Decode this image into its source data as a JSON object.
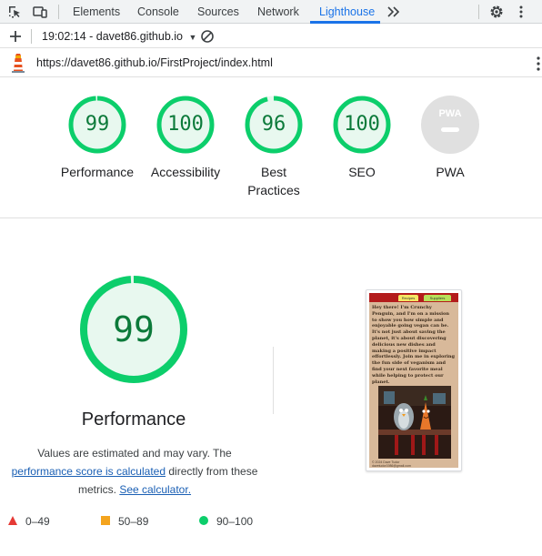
{
  "tabs": [
    {
      "label": "Elements"
    },
    {
      "label": "Console"
    },
    {
      "label": "Sources"
    },
    {
      "label": "Network"
    },
    {
      "label": "Lighthouse",
      "active": true
    }
  ],
  "toolbar": {
    "report_label": "19:02:14 - davet86.github.io"
  },
  "url": "https://davet86.github.io/FirstProject/index.html",
  "categories": [
    {
      "score": "99",
      "label": "Performance",
      "fraction": 0.99,
      "status": "pass"
    },
    {
      "score": "100",
      "label": "Accessibility",
      "fraction": 1.0,
      "status": "pass"
    },
    {
      "score": "96",
      "label": "Best Practices",
      "fraction": 0.96,
      "status": "pass"
    },
    {
      "score": "100",
      "label": "SEO",
      "fraction": 1.0,
      "status": "pass"
    },
    {
      "score": "",
      "label": "PWA",
      "fraction": 0,
      "status": "na",
      "badge": "PWA"
    }
  ],
  "performance": {
    "score": "99",
    "fraction": 0.99,
    "title": "Performance",
    "note_start": "Values are estimated and may vary. The",
    "link_score": "performance score is calculated",
    "note_mid": "directly from these metrics.",
    "link_calc": "See calculator."
  },
  "legend": [
    {
      "range": "0–49",
      "color": "#e53935",
      "shape": "triangle"
    },
    {
      "range": "50–89",
      "color": "#f4a41e",
      "shape": "square"
    },
    {
      "range": "90–100",
      "color": "#0cce6b",
      "shape": "circle"
    }
  ],
  "thumbnail": {
    "tabs": [
      "Recipes",
      "Suppliers"
    ],
    "text": "Hey there! I'm Crunchy Penguin, and I'm on a mission to show you how simple and enjoyable going vegan can be. It's not just about saving the planet, it's about discovering delicious new dishes and making a positive impact effortlessly. Join me in exploring the fun side of veganism and find your next favorite meal while helping to protect our planet.",
    "footer": "© 2024 Dave Tudor davetudor1986@gmail.com"
  },
  "colors": {
    "pass": "#0cce6b",
    "pass_bg": "#e8f8ef",
    "pass_text": "#0c7a3a",
    "accent": "#1a73e8",
    "na": "#e0e0e0"
  }
}
